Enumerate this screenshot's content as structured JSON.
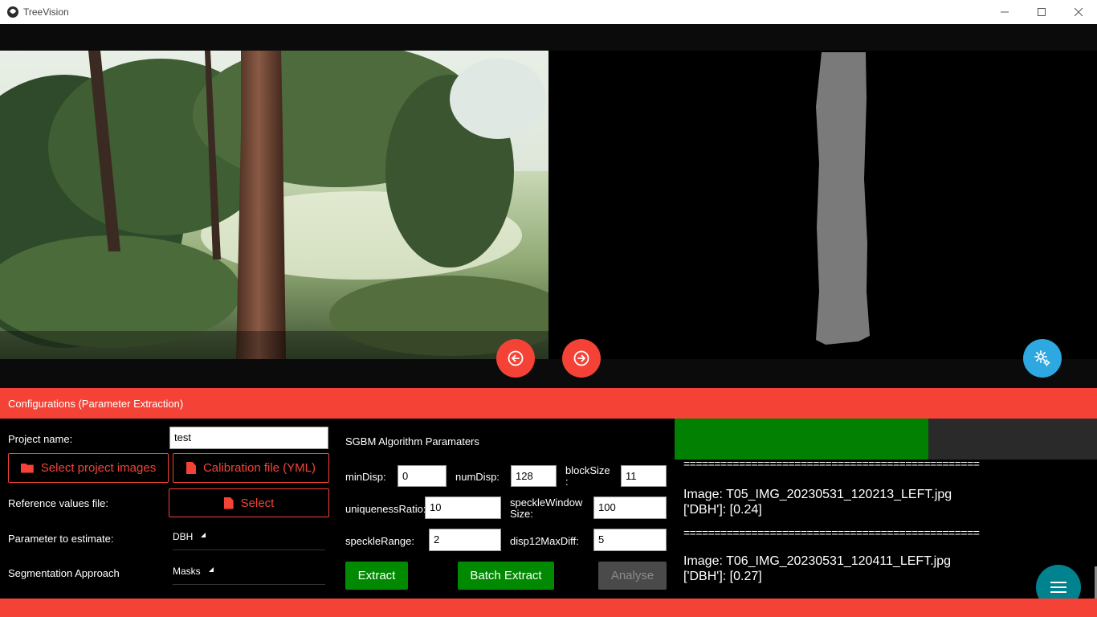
{
  "window": {
    "title": "TreeVision"
  },
  "viewer": {
    "prev_button_icon": "arrow-left-circle-icon",
    "next_button_icon": "arrow-right-circle-icon",
    "settings_button_icon": "gear-icon"
  },
  "config": {
    "header": "Configurations (Parameter Extraction)",
    "project_name_label": "Project name:",
    "project_name_value": "test",
    "select_images_label": "Select project images",
    "calibration_label": "Calibration file (YML)",
    "reference_label": "Reference values file:",
    "reference_select_label": "Select",
    "parameter_label": "Parameter to estimate:",
    "parameter_value": "DBH",
    "segmentation_label": "Segmentation Approach",
    "segmentation_value": "Masks"
  },
  "sgbm": {
    "title": "SGBM Algorithm Paramaters",
    "minDisp_label": "minDisp:",
    "minDisp_value": "0",
    "numDisp_label": "numDisp:",
    "numDisp_value": "128",
    "blockSize_label_1": "blockSize",
    "blockSize_label_2": ":",
    "blockSize_value": "11",
    "uniqueness_label": "uniquenessRatio:",
    "uniqueness_value": "10",
    "speckleWindow_label_1": "speckleWindow",
    "speckleWindow_label_2": "Size:",
    "speckleWindow_value": "100",
    "speckleRange_label": "speckleRange:",
    "speckleRange_value": "2",
    "disp12_label": "disp12MaxDiff:",
    "disp12_value": "5",
    "extract_label": "Extract",
    "batch_extract_label": "Batch Extract",
    "analyse_label": "Analyse"
  },
  "progress": {
    "value": 0.6
  },
  "log": {
    "separator": "================================================",
    "entries": [
      {
        "image": "Image: T05_IMG_20230531_120213_LEFT.jpg",
        "result": "['DBH']: [0.24]"
      },
      {
        "image": "Image: T06_IMG_20230531_120411_LEFT.jpg",
        "result": "['DBH']: [0.27]"
      }
    ]
  },
  "fab_icon": "menu-icon",
  "colors": {
    "accent": "#f44336",
    "green": "#018a01",
    "blue": "#2ea8e0",
    "teal": "#00838f"
  }
}
